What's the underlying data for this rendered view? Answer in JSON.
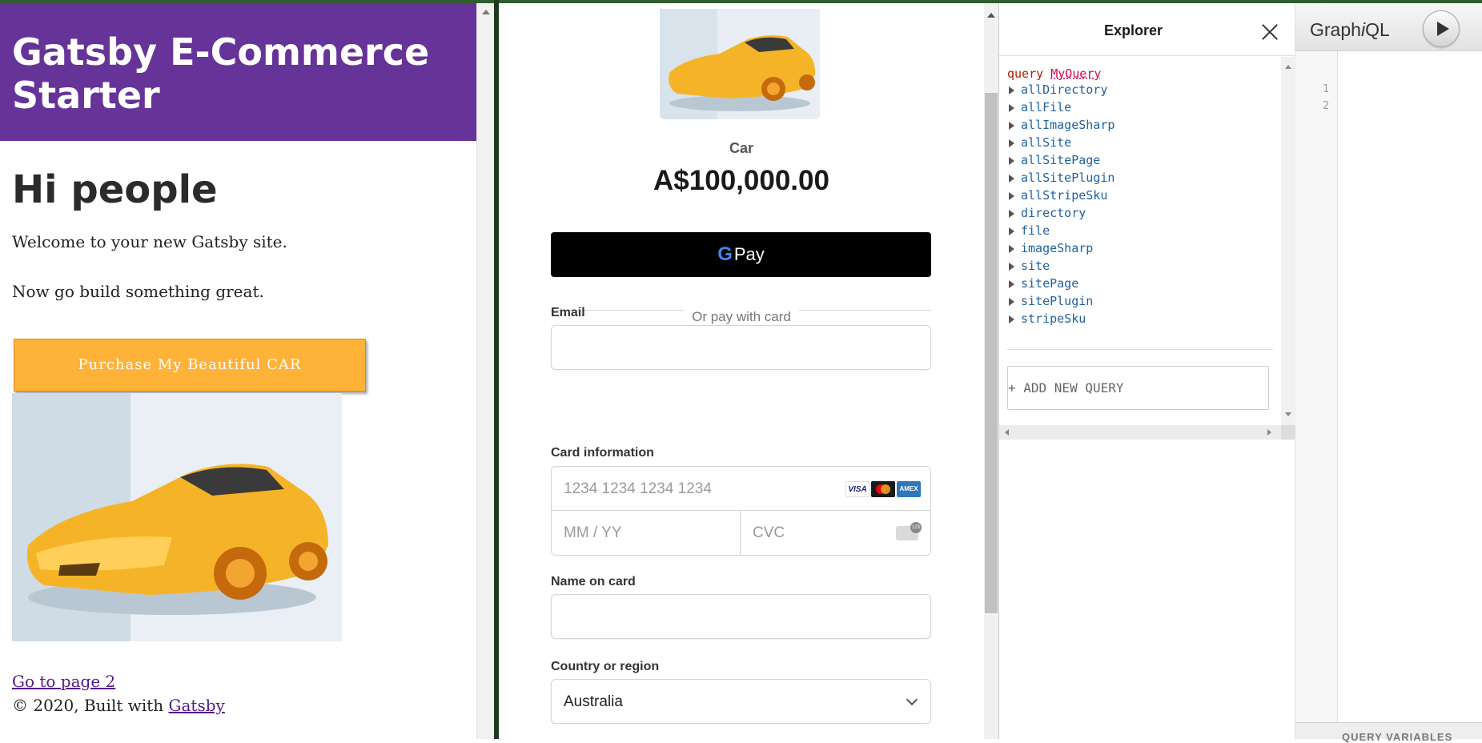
{
  "site": {
    "title": "Gatsby E-Commerce Starter",
    "heading": "Hi people",
    "welcome": "Welcome to your new Gatsby site.",
    "tagline": "Now go build something great.",
    "purchase_label": "Purchase My Beautiful CAR",
    "page2_link": "Go to page 2",
    "footer_prefix": "© 2020, Built with",
    "footer_link": "Gatsby"
  },
  "checkout": {
    "product_name": "Car",
    "price": "A$100,000.00",
    "gpay_label": "Pay",
    "or_text": "Or pay with card",
    "email_label": "Email",
    "email_value": "",
    "card_label": "Card information",
    "card_number_placeholder": "1234 1234 1234 1234",
    "expiry_placeholder": "MM / YY",
    "cvc_placeholder": "CVC",
    "card_brands": [
      "VISA",
      "mastercard",
      "AMEX"
    ],
    "name_label": "Name on card",
    "name_value": "",
    "country_label": "Country or region",
    "country_value": "Australia"
  },
  "explorer": {
    "title": "Explorer",
    "query_keyword": "query",
    "query_name": "MyQuery",
    "fields": [
      "allDirectory",
      "allFile",
      "allImageSharp",
      "allSite",
      "allSitePage",
      "allSitePlugin",
      "allStripeSku",
      "directory",
      "file",
      "imageSharp",
      "site",
      "sitePage",
      "sitePlugin",
      "stripeSku"
    ],
    "add_query_label": "+ ADD NEW QUERY"
  },
  "graphiql": {
    "title_prefix": "Graph",
    "title_italic": "i",
    "title_suffix": "QL",
    "line_numbers": [
      "1",
      "2"
    ],
    "query_variables_label": "QUERY VARIABLES"
  },
  "colors": {
    "site_header": "#663399",
    "purchase_button": "#ffb238",
    "explorer_field": "#1f61a0",
    "query_keyword": "#b11a04"
  }
}
